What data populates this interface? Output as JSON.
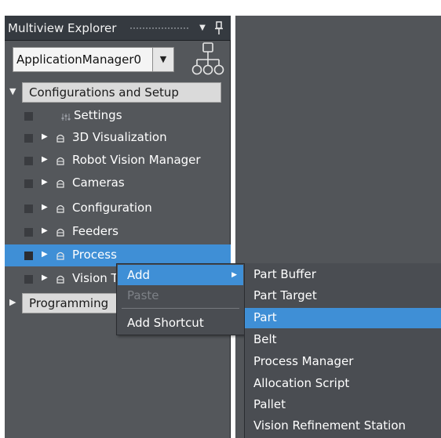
{
  "explorer": {
    "title": "Multiview Explorer",
    "app_selector_value": "ApplicationManager0",
    "sections": [
      {
        "label": "Configurations and Setup",
        "expanded": true
      },
      {
        "label": "Programming",
        "expanded": false
      }
    ],
    "tree_items": [
      {
        "label": "Settings",
        "icon": "settings-icon",
        "selected": false
      },
      {
        "label": "3D Visualization",
        "icon": "folder-icon",
        "selected": false
      },
      {
        "label": "Robot Vision Manager",
        "icon": "folder-icon",
        "selected": false
      },
      {
        "label": "Cameras",
        "icon": "folder-icon",
        "selected": false
      },
      {
        "label": "Configuration",
        "icon": "folder-icon",
        "selected": false
      },
      {
        "label": "Feeders",
        "icon": "folder-icon",
        "selected": false
      },
      {
        "label": "Process",
        "icon": "folder-icon",
        "selected": true
      },
      {
        "label": "Vision T",
        "icon": "folder-icon",
        "selected": false
      }
    ]
  },
  "context_menu": {
    "items": [
      {
        "label": "Add",
        "has_submenu": true,
        "active": true,
        "disabled": false
      },
      {
        "label": "Paste",
        "has_submenu": false,
        "active": false,
        "disabled": true
      },
      {
        "label": "Add Shortcut",
        "has_submenu": false,
        "active": false,
        "disabled": false
      }
    ]
  },
  "submenu": {
    "items": [
      {
        "label": "Part Buffer",
        "active": false
      },
      {
        "label": "Part Target",
        "active": false
      },
      {
        "label": "Part",
        "active": true
      },
      {
        "label": "Belt",
        "active": false
      },
      {
        "label": "Process Manager",
        "active": false
      },
      {
        "label": "Allocation Script",
        "active": false
      },
      {
        "label": "Pallet",
        "active": false
      },
      {
        "label": "Vision Refinement Station",
        "active": false
      }
    ]
  },
  "colors": {
    "panel_bg": "#54575b",
    "header_bg": "#353a40",
    "selection": "#3f8fd6",
    "section_bg": "#dadada",
    "menu_bg": "#4a4d52",
    "workspace_bg": "#525559"
  }
}
